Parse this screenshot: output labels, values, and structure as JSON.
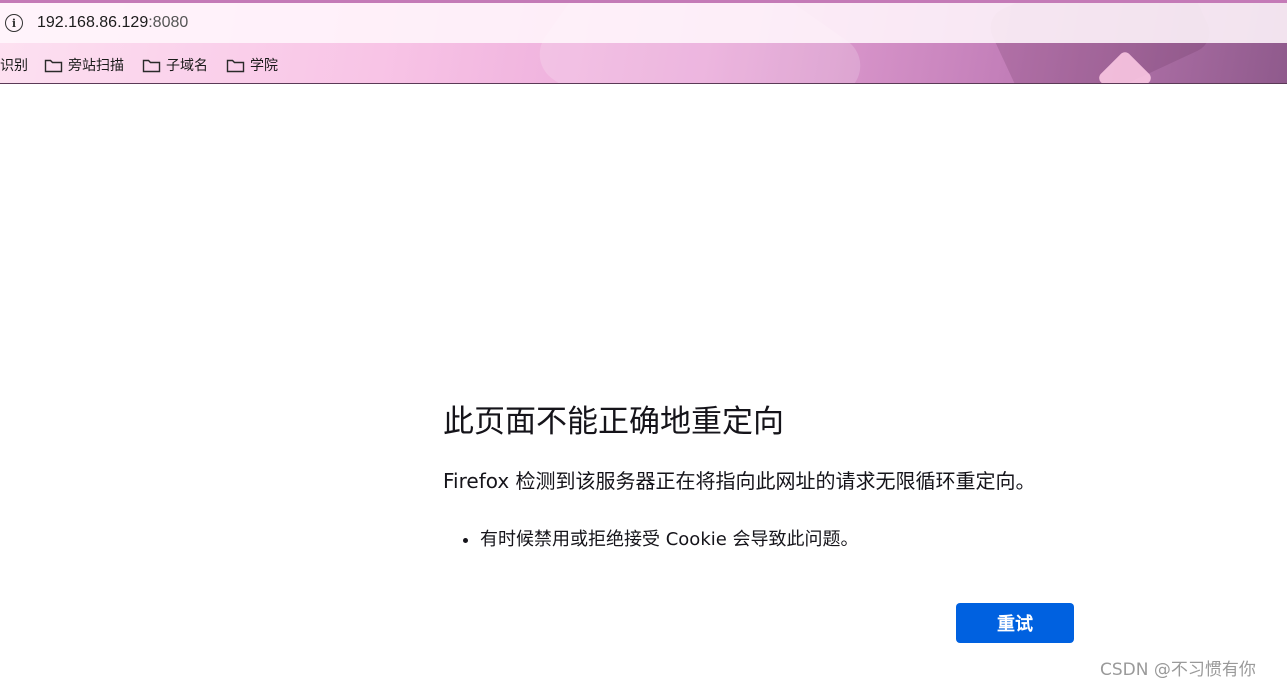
{
  "browser": {
    "url_host": "192.168.86.129",
    "url_port": ":8080",
    "bookmarks": [
      {
        "label": "识别",
        "icon": "none"
      },
      {
        "label": "旁站扫描",
        "icon": "folder-icon"
      },
      {
        "label": "子域名",
        "icon": "folder-icon"
      },
      {
        "label": "学院",
        "icon": "folder-icon"
      }
    ]
  },
  "error_page": {
    "title": "此页面不能正确地重定向",
    "description": "Firefox 检测到该服务器正在将指向此网址的请求无限循环重定向。",
    "bullets": [
      "有时候禁用或拒绝接受 Cookie 会导致此问题。"
    ],
    "retry_label": "重试"
  },
  "watermark": "CSDN @不习惯有你",
  "colors": {
    "primary_button": "#0061e0",
    "text": "#15141a"
  }
}
